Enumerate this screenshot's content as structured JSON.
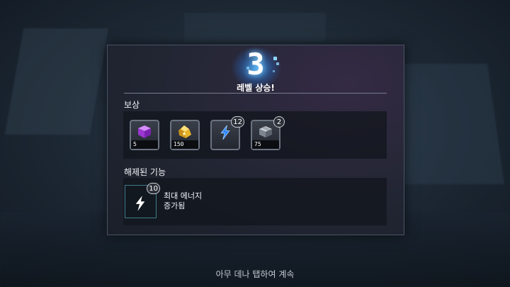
{
  "level": {
    "number": "3",
    "label": "레벨 상승!"
  },
  "rewards": {
    "title": "보상",
    "items": [
      {
        "icon": "purple-cube-icon",
        "count": "5",
        "badge": ""
      },
      {
        "icon": "gold-ore-icon",
        "count": "150",
        "badge": ""
      },
      {
        "icon": "energy-bolt-icon",
        "count": "",
        "badge": "12"
      },
      {
        "icon": "metal-block-icon",
        "count": "75",
        "badge": "2"
      }
    ]
  },
  "unlocked": {
    "title": "해제된 기능",
    "feature": {
      "icon": "energy-bolt-icon",
      "badge": "10",
      "line1": "최대 에너지",
      "line2": "증가됨"
    }
  },
  "hint": "아무 데나 탭하여 계속",
  "colors": {
    "accent_glow": "#46aaff",
    "panel_bg": "#222633",
    "bolt_blue": "#2e86ff",
    "gold": "#e6b22a",
    "purple": "#b04be0"
  }
}
